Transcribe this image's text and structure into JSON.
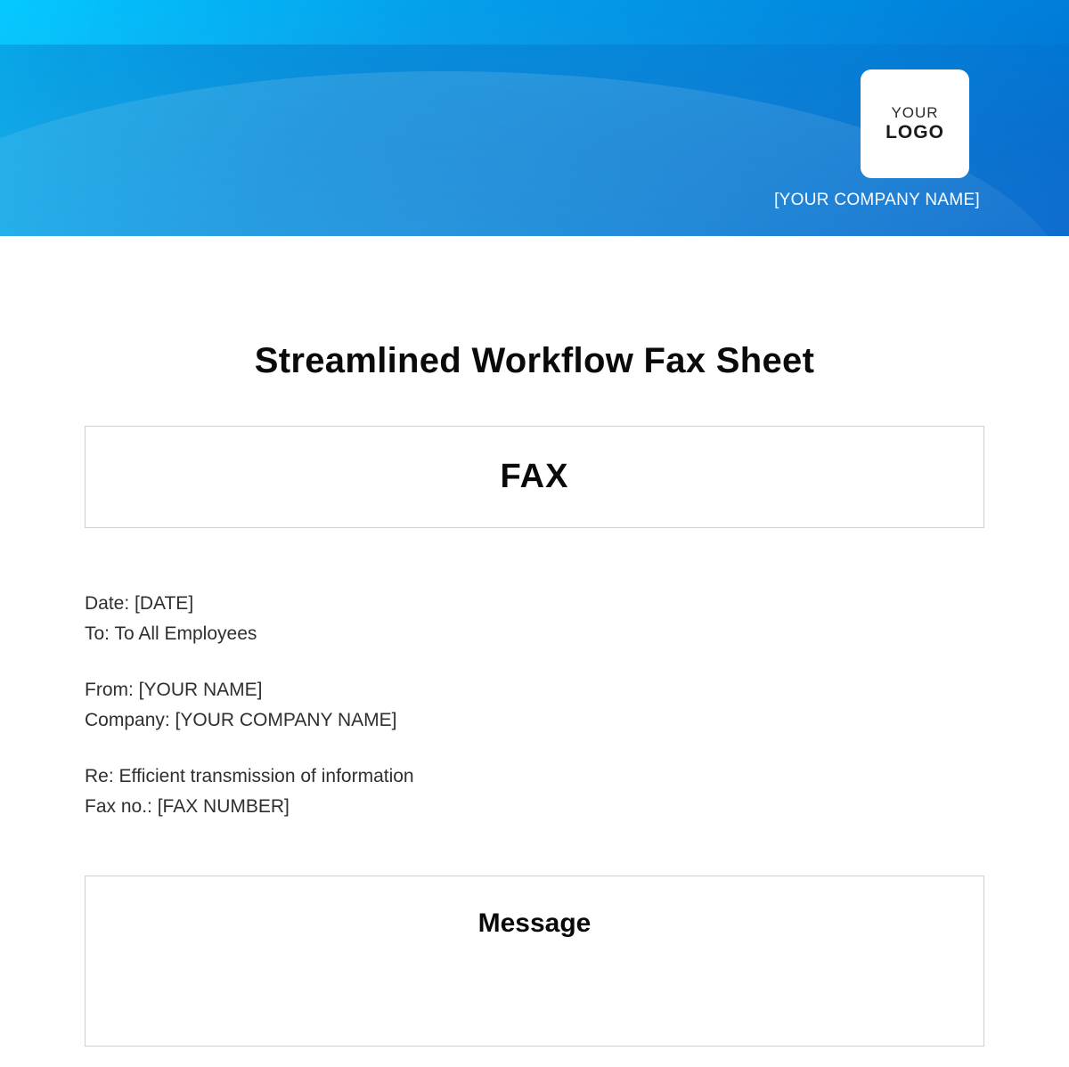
{
  "header": {
    "logo_line1": "YOUR",
    "logo_line2": "LOGO",
    "company_name": "[YOUR COMPANY NAME]"
  },
  "document": {
    "title": "Streamlined Workflow Fax Sheet",
    "fax_label": "FAX",
    "message_label": "Message"
  },
  "fields": {
    "date_label": "Date: ",
    "date_value": "[DATE]",
    "to_label": "To: ",
    "to_value": "To All Employees",
    "from_label": "From: ",
    "from_value": "[YOUR NAME]",
    "company_label": "Company: ",
    "company_value": "[YOUR COMPANY NAME]",
    "re_label": "Re: ",
    "re_value": "Efficient transmission of information",
    "faxno_label": "Fax no.: ",
    "faxno_value": "[FAX NUMBER]"
  }
}
